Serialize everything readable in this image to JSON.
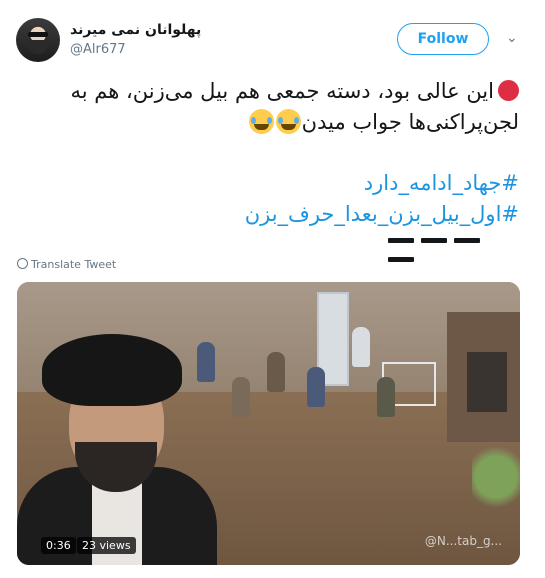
{
  "header": {
    "display_name": "پهلوانان نمی میرند",
    "handle": "@Alr677",
    "follow_label": "Follow",
    "menu_icon": "chevron-down-icon"
  },
  "tweet": {
    "line1": "این عالی بود، دسته جمعی هم بیل می‌زنن، هم به",
    "line2": "لجن‌پراکنی‌ها جواب میدن",
    "hashtag1": "#جهاد_ادامه_دارد",
    "hashtag2": "#اول_بیل_بزن_بعدا_حرف_بزن",
    "emoji": "tears-of-joy-icon",
    "status_icon": "red-circle-icon"
  },
  "translate_label": "Translate Tweet",
  "video": {
    "duration": "0:36",
    "views": "23 views",
    "watermark": "@N...tab_g..."
  },
  "colors": {
    "accent": "#1da1f2",
    "hashtag": "#1b95e0",
    "red": "#dd2e44"
  }
}
